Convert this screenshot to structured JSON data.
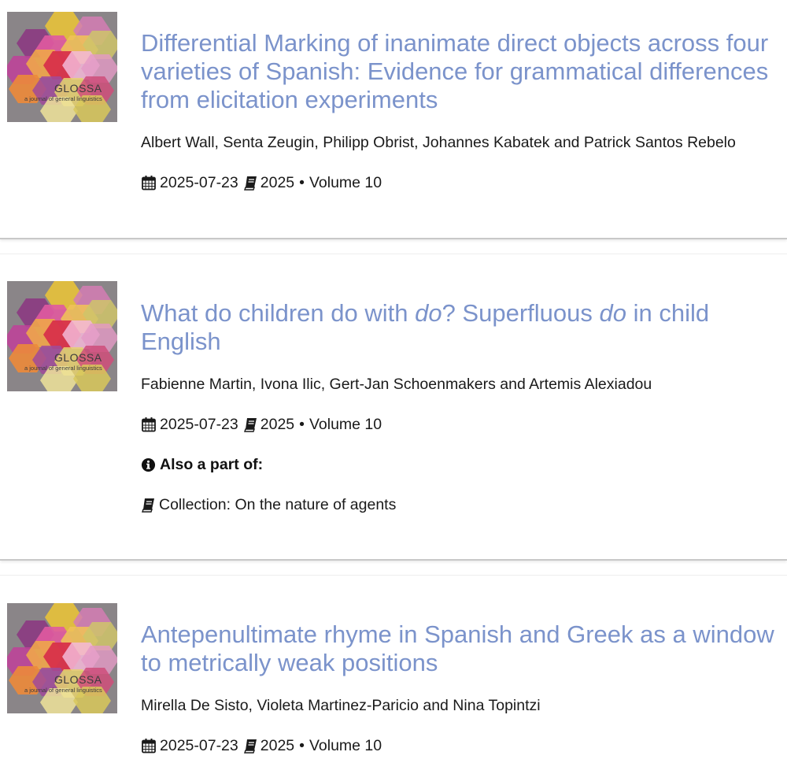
{
  "articles": [
    {
      "cover": {
        "title": "GLOSSA",
        "subtitle": "a journal of general linguistics",
        "icon": "journal-cover-hexagons"
      },
      "title": "Differential Marking of inanimate direct objects across four varieties of Spanish: Evidence for grammatical differences from elicitation experiments",
      "authors": "Albert Wall, Senta Zeugin, Philipp Obrist, Johannes Kabatek and Patrick Santos Rebelo",
      "date": "2025-07-23",
      "year": "2025",
      "separator": "•",
      "volume": "Volume 10"
    },
    {
      "cover": {
        "title": "GLOSSA",
        "subtitle": "a journal of general linguistics",
        "icon": "journal-cover-hexagons"
      },
      "title_parts": [
        "What do children do with ",
        "do",
        "? Superfluous ",
        "do",
        " in child English"
      ],
      "authors": "Fabienne Martin, Ivona Ilic, Gert-Jan Schoenmakers and Artemis Alexiadou",
      "date": "2025-07-23",
      "year": "2025",
      "separator": "•",
      "volume": "Volume 10",
      "also_part_of": "Also a part of:",
      "collection": "Collection: On the nature of agents"
    },
    {
      "cover": {
        "title": "GLOSSA",
        "subtitle": "a journal of general linguistics",
        "icon": "journal-cover-hexagons"
      },
      "title": "Antepenultimate rhyme in Spanish and Greek as a window to metrically weak positions",
      "authors": "Mirella De Sisto, Violeta Martinez-Paricio and Nina Topintzi",
      "date": "2025-07-23",
      "year": "2025",
      "separator": "•",
      "volume": "Volume 10"
    }
  ],
  "icons": {
    "date": "calendar-icon",
    "issue": "book-icon",
    "info": "info-circle-icon",
    "collection": "book-icon"
  },
  "colors": {
    "title_link": "#7b93cb",
    "text": "#1a1a1a",
    "cover_bg": "#8a8588"
  }
}
